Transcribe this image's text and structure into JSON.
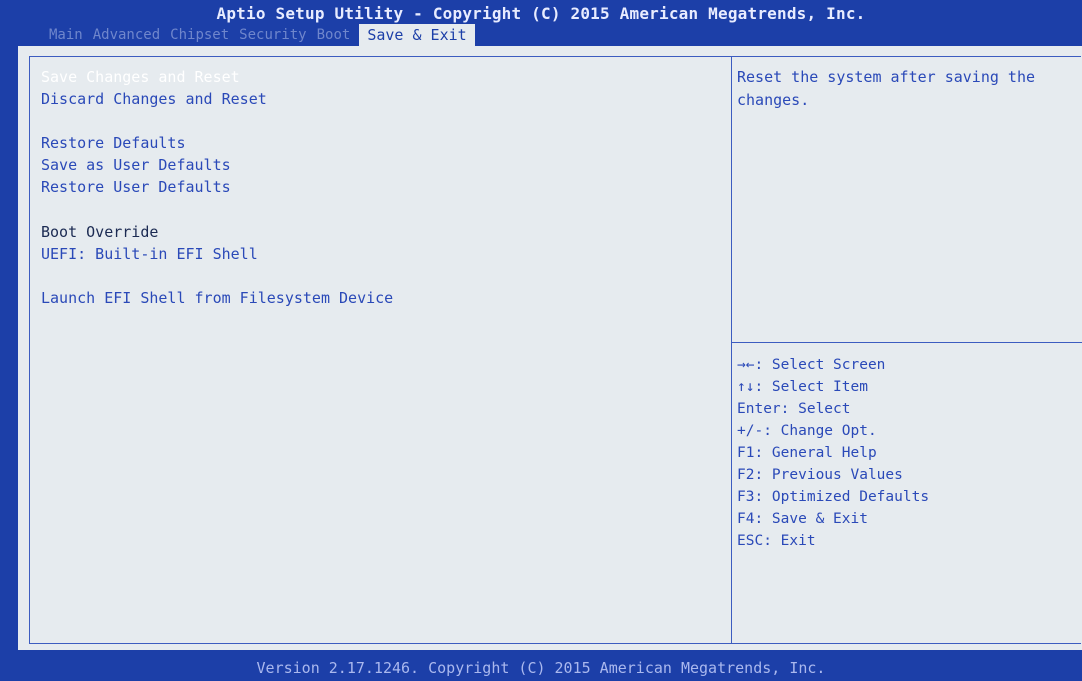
{
  "header": {
    "title": "Aptio Setup Utility - Copyright (C) 2015 American Megatrends, Inc.",
    "tabs": [
      {
        "label": "Main",
        "active": false
      },
      {
        "label": "Advanced",
        "active": false
      },
      {
        "label": "Chipset",
        "active": false
      },
      {
        "label": "Security",
        "active": false
      },
      {
        "label": "Boot",
        "active": false
      },
      {
        "label": "Save & Exit",
        "active": true
      }
    ]
  },
  "menu": {
    "items": [
      {
        "label": "Save Changes and Reset",
        "selected": true
      },
      {
        "label": "Discard Changes and Reset"
      },
      {
        "label": "Restore Defaults"
      },
      {
        "label": "Save as User Defaults"
      },
      {
        "label": "Restore User Defaults"
      },
      {
        "label": "Boot Override",
        "static": true
      },
      {
        "label": "UEFI: Built-in EFI Shell"
      },
      {
        "label": "Launch EFI Shell from Filesystem Device"
      }
    ]
  },
  "help": {
    "text": "Reset the system after saving the changes."
  },
  "keys": [
    "→←: Select Screen",
    "↑↓: Select Item",
    "Enter: Select",
    "+/-: Change Opt.",
    "F1: General Help",
    "F2: Previous Values",
    "F3: Optimized Defaults",
    "F4: Save & Exit",
    "ESC: Exit"
  ],
  "footer": {
    "text": "Version 2.17.1246. Copyright (C) 2015 American Megatrends, Inc."
  },
  "colors": {
    "bios_blue": "#1c3fa8",
    "panel_bg": "#e6ebef",
    "item_text": "#2a49b8",
    "selected_text": "#ffffff"
  }
}
